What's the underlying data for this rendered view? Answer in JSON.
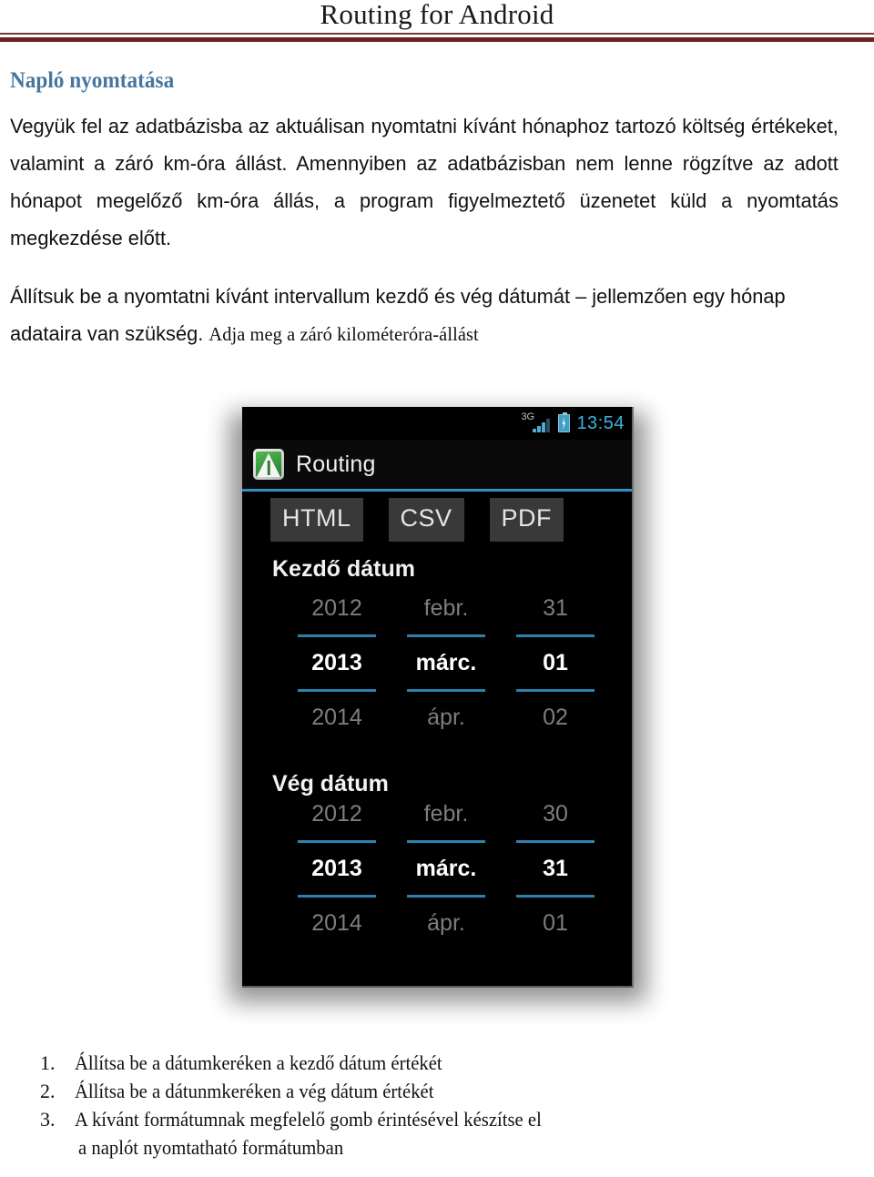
{
  "document": {
    "header_title": "Routing for Android",
    "section_heading": "Napló nyomtatása",
    "paragraph_1": "Vegyük fel az adatbázisba az aktuálisan nyomtatni kívánt hónaphoz tartozó költség értékeket, valamint a záró km-óra állást. Amennyiben az adatbázisban nem lenne rögzítve az adott hónapot megelőző km-óra állás, a program figyelmeztető üzenetet küld a nyomtatás megkezdése előtt.",
    "paragraph_2_main": "Állítsuk be a nyomtatni kívánt intervallum kezdő és vég dátumát – jellemzően egy hónap adataira van szükség. ",
    "paragraph_2_tail": "Adja meg a záró kilométeróra-állást",
    "rule_color": "#6d2121",
    "heading_color": "#46769f"
  },
  "screenshot": {
    "statusbar": {
      "network_label": "3G",
      "signal_icon": "signal-bars-icon",
      "battery_icon": "battery-charging-icon",
      "clock": "13:54",
      "clock_color": "#3ab4e0"
    },
    "actionbar": {
      "app_icon": "routing-app-icon",
      "app_title": "Routing",
      "accent_color": "#2f90c4"
    },
    "format_buttons": [
      {
        "label": "HTML",
        "name": "html-export-button"
      },
      {
        "label": "CSV",
        "name": "csv-export-button"
      },
      {
        "label": "PDF",
        "name": "pdf-export-button"
      }
    ],
    "start_date": {
      "label": "Kezdő dátum",
      "year": {
        "prev": "2012",
        "selected": "2013",
        "next": "2014"
      },
      "month": {
        "prev": "febr.",
        "selected": "márc.",
        "next": "ápr."
      },
      "day": {
        "prev": "31",
        "selected": "01",
        "next": "02"
      }
    },
    "end_date": {
      "label": "Vég dátum",
      "year": {
        "prev": "2012",
        "selected": "2013",
        "next": "2014"
      },
      "month": {
        "prev": "febr.",
        "selected": "márc.",
        "next": "ápr."
      },
      "day": {
        "prev": "30",
        "selected": "31",
        "next": "01"
      }
    }
  },
  "steps": [
    {
      "num": "1.",
      "text": "Állítsa be a dátumkeréken a kezdő dátum értékét"
    },
    {
      "num": "2.",
      "text": "Állítsa be a dátunmkeréken a vég dátum értékét"
    },
    {
      "num": "3.",
      "text": "A kívánt formátumnak megfelelő gomb érintésével készítse el",
      "continuation": "a naplót nyomtatható formátumban"
    }
  ]
}
